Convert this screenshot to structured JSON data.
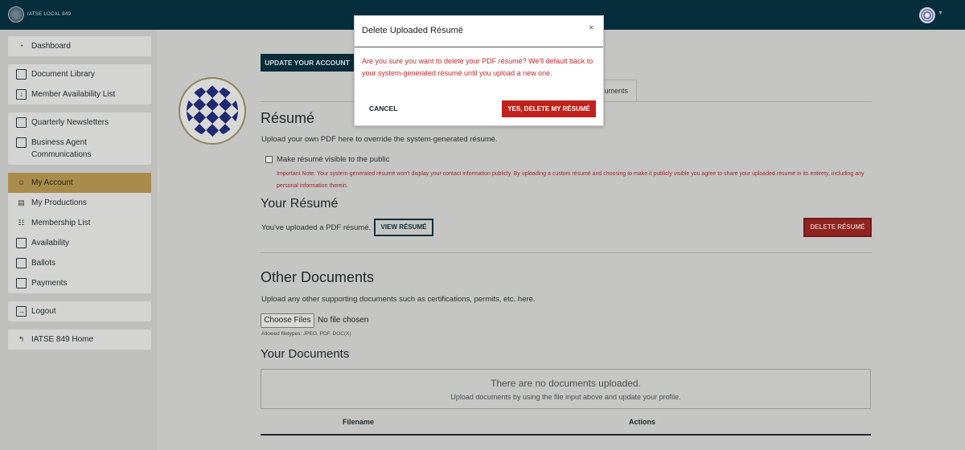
{
  "header": {
    "logo_text": "IATSE LOCAL 849"
  },
  "sidebar": {
    "dashboard": "Dashboard",
    "document_library": "Document Library",
    "member_availability_list": "Member Availability List",
    "quarterly_newsletters": "Quarterly Newsletters",
    "business_agent_communications": "Business Agent Communications",
    "my_account": "My Account",
    "my_productions": "My Productions",
    "membership_list": "Membership List",
    "availability": "Availability",
    "ballots": "Ballots",
    "payments": "Payments",
    "logout": "Logout",
    "iatse_home": "IATSE 849 Home",
    "active_color": "#a98c4b"
  },
  "main": {
    "update_account_label": "UPDATE YOUR ACCOUNT",
    "documents_tab_label": "uments",
    "resume_heading": "Résumé",
    "resume_desc": "Upload your own PDF here to override the system-generated résumé.",
    "visible_checkbox_label": "Make résumé visible to the public",
    "important_note": "Important Note: Your system-generated résumé won't display your contact information publicly. By uploading a custom résumé and choosing to make it publicly visible you agree to share your uploaded résumé in its entirety, including any personal information therein.",
    "your_resume_heading": "Your Résumé",
    "uploaded_text": "You've uploaded a PDF résumé.",
    "view_resume_label": "VIEW RÉSUMÉ",
    "delete_resume_label": "DELETE RÉSUMÉ",
    "other_docs_heading": "Other Documents",
    "other_docs_desc": "Upload any other supporting documents such as certifications, permits, etc. here.",
    "choose_files_label": "Choose Files",
    "no_file_text": "No file chosen",
    "allowed_types": "Allowed filetypes: JPEG, PDF, DOC(X)",
    "your_docs_heading": "Your Documents",
    "empty_title": "There are no documents uploaded.",
    "empty_sub": "Upload documents by using the file input above and update your profile.",
    "columns": [
      "Filename",
      "Actions"
    ]
  },
  "modal": {
    "title": "Delete Uploaded Résumé",
    "close": "×",
    "message": "Are you sure you want to delete your PDF résumé? We'll default back to your system-generated résumé until you upload a new one.",
    "cancel_label": "CANCEL",
    "confirm_label": "YES, DELETE MY RÉSUMÉ",
    "confirm_color": "#c1211b",
    "message_color": "#c0282d"
  }
}
